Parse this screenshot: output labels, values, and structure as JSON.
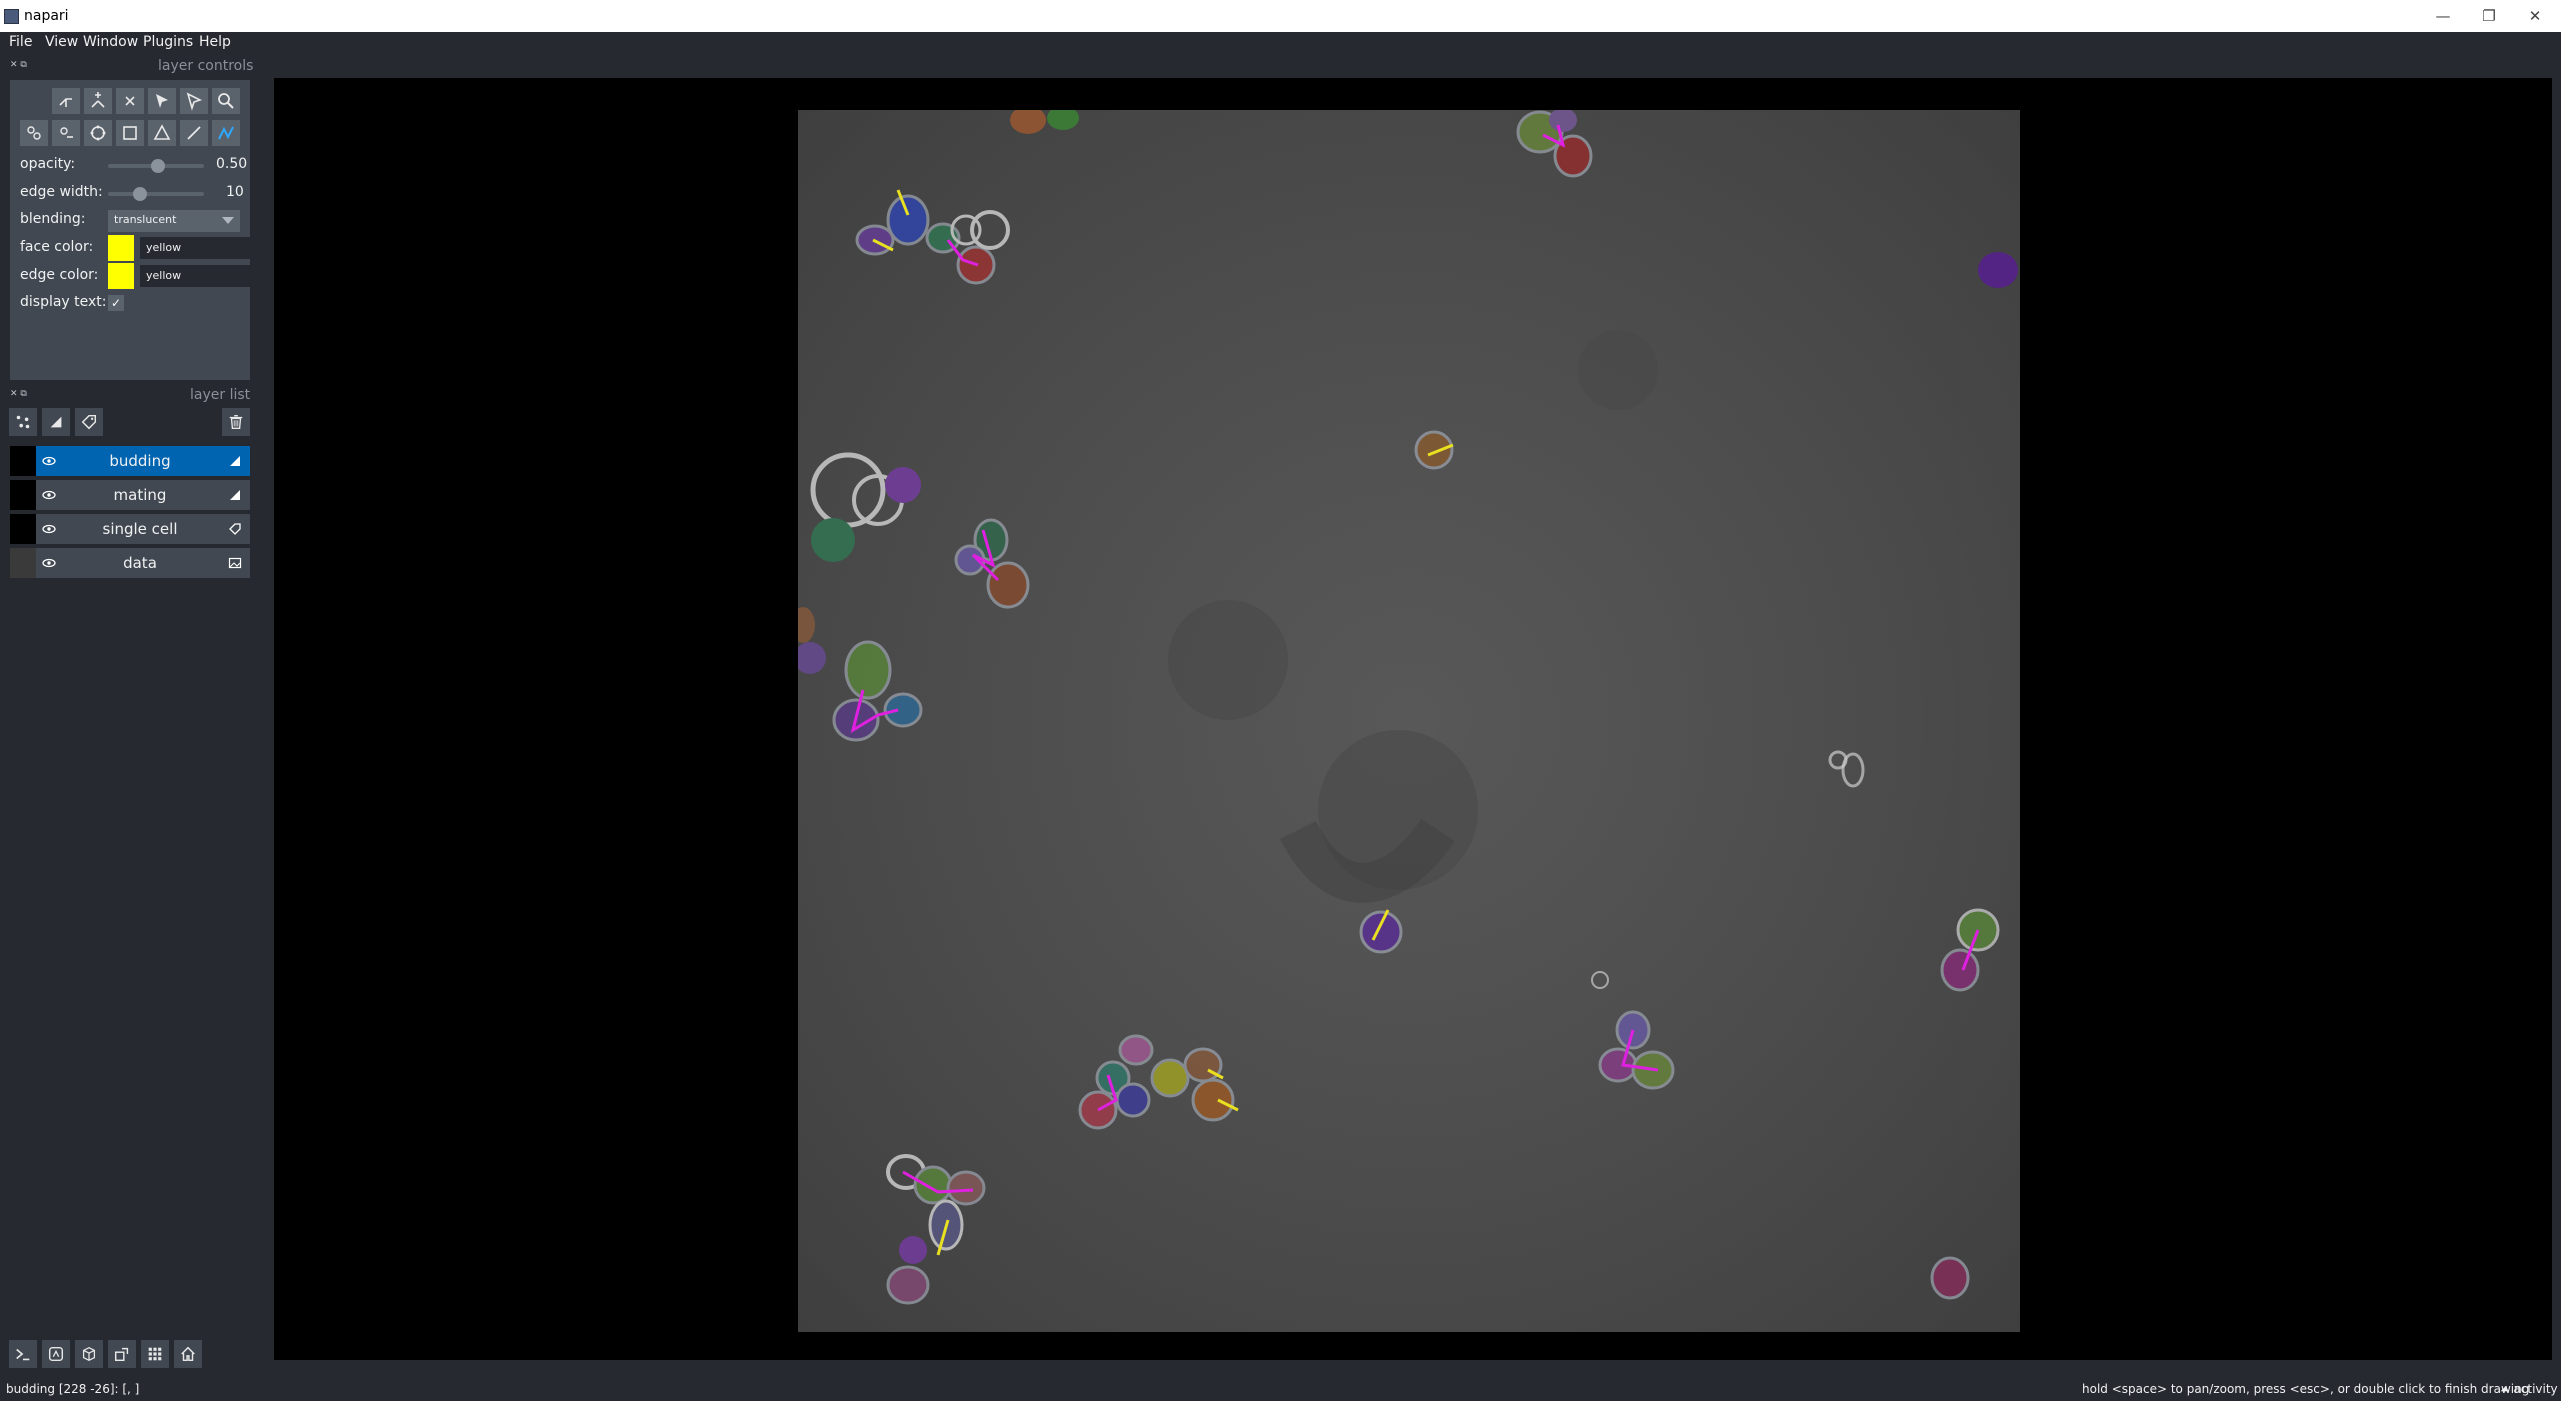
{
  "window": {
    "title": "napari",
    "minimize": "—",
    "restore": "❐",
    "close": "✕"
  },
  "menu": [
    "File",
    "View",
    "Window",
    "Plugins",
    "Help"
  ],
  "layer_controls": {
    "title": "layer controls",
    "opacity": {
      "label": "opacity:",
      "value": "0.50"
    },
    "edge_width": {
      "label": "edge width:",
      "value": "10"
    },
    "blending": {
      "label": "blending:",
      "value": "translucent"
    },
    "face_color": {
      "label": "face color:",
      "value": "yellow",
      "swatch": "#ffff00"
    },
    "edge_color": {
      "label": "edge color:",
      "value": "yellow",
      "swatch": "#ffff00"
    },
    "display_text": {
      "label": "display text:",
      "checked": "✓"
    }
  },
  "layer_list": {
    "title": "layer list",
    "layers": [
      {
        "name": "budding",
        "type": "shapes",
        "selected": true
      },
      {
        "name": "mating",
        "type": "shapes",
        "selected": false
      },
      {
        "name": "single cell",
        "type": "labels",
        "selected": false
      },
      {
        "name": "data",
        "type": "image",
        "selected": false
      }
    ]
  },
  "status": {
    "left": "budding [228 -26]: [, ]",
    "hint": "hold <space> to pan/zoom, press <esc>, or double click to finish drawing",
    "activity": "activity"
  },
  "colors": {
    "accent": "#0064b0",
    "background": "#262930",
    "panel": "#414851",
    "canvas": "#000000"
  }
}
